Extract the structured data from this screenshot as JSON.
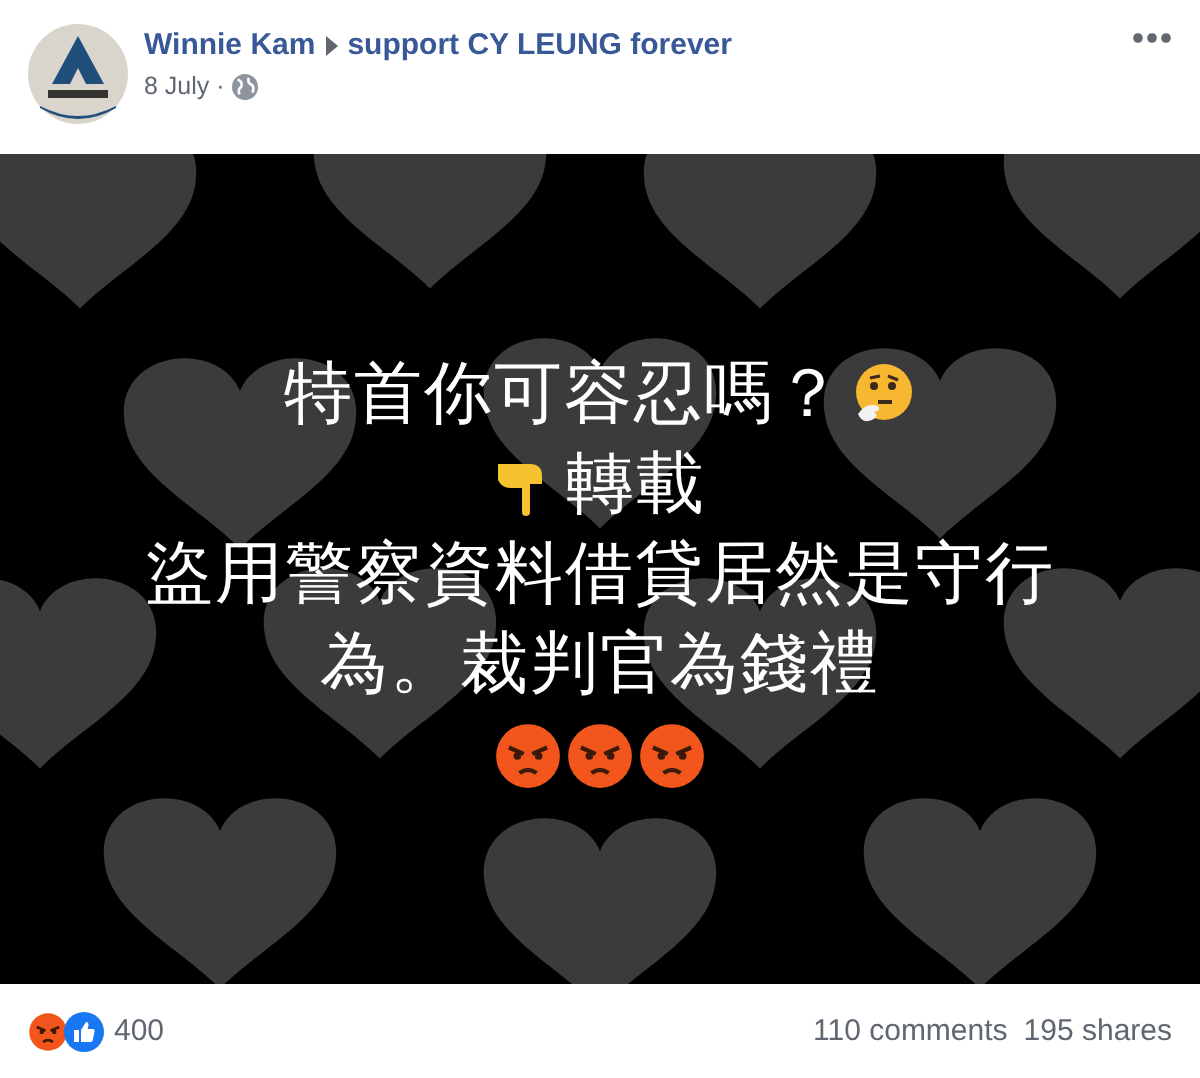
{
  "post": {
    "author": "Winnie Kam",
    "target": "support CY LEUNG forever",
    "date": "8 July ·"
  },
  "image": {
    "kind": "picture",
    "lines": [
      {
        "parts": [
          {
            "kind": "text",
            "text": "特首你可容忍嗎？"
          },
          {
            "kind": "thinking"
          }
        ]
      },
      {
        "parts": [
          {
            "kind": "pointing"
          },
          {
            "kind": "text",
            "text": "轉載"
          }
        ]
      },
      {
        "parts": [
          {
            "kind": "text",
            "text": "盜用警察資料借貸居然是守行"
          }
        ]
      },
      {
        "parts": [
          {
            "kind": "text",
            "text": "為。裁判官為錢禮"
          }
        ]
      }
    ],
    "trailing_emojis": [
      {
        "kind": "angry"
      },
      {
        "kind": "angry"
      },
      {
        "kind": "angry"
      }
    ]
  },
  "footer": {
    "reactions": [
      {
        "kind": "angry"
      },
      {
        "kind": "like"
      }
    ],
    "reaction_count": "400",
    "comments": "110 comments",
    "shares": "195 shares"
  }
}
